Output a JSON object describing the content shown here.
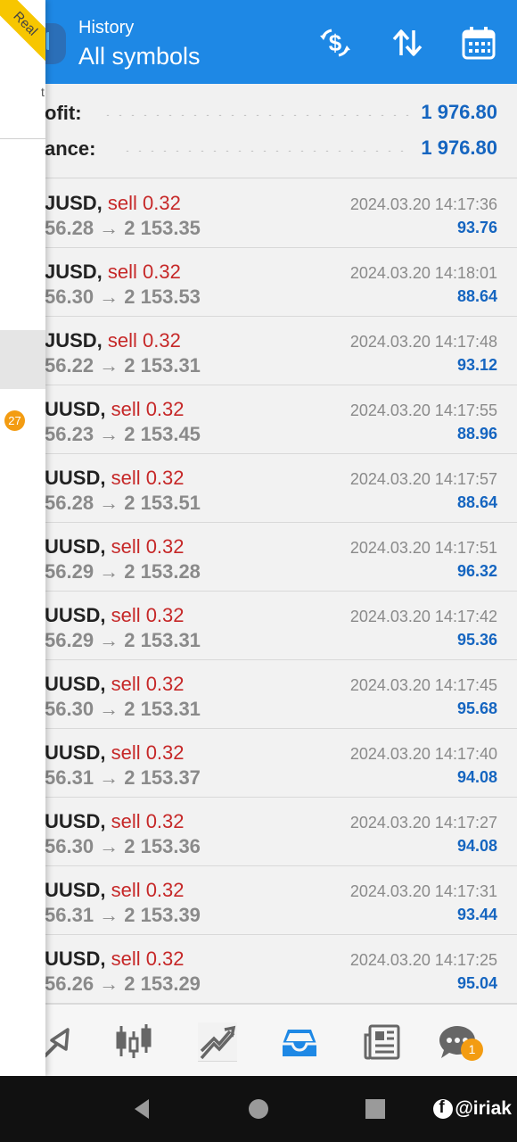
{
  "header": {
    "small_title": "History",
    "big_title": "All symbols",
    "icons": [
      "currency-exchange-icon",
      "sort-icon",
      "calendar-icon"
    ]
  },
  "summary": {
    "profit_label": "ofit:",
    "profit_value": "1 976.80",
    "balance_label": "ance:",
    "balance_value": "1 976.80"
  },
  "drawer": {
    "ribbon_label": "Real",
    "partial_letter": "t",
    "badge": "27"
  },
  "trades": [
    {
      "symbol": "JUSD,",
      "side": "sell 0.32",
      "prices": "56.28 → 2 153.35",
      "time": "2024.03.20 14:17:36",
      "profit": "93.76"
    },
    {
      "symbol": "JUSD,",
      "side": "sell 0.32",
      "prices": "56.30 → 2 153.53",
      "time": "2024.03.20 14:18:01",
      "profit": "88.64"
    },
    {
      "symbol": "JUSD,",
      "side": "sell 0.32",
      "prices": "56.22 → 2 153.31",
      "time": "2024.03.20 14:17:48",
      "profit": "93.12"
    },
    {
      "symbol": "UUSD,",
      "side": "sell 0.32",
      "prices": "56.23 → 2 153.45",
      "time": "2024.03.20 14:17:55",
      "profit": "88.96"
    },
    {
      "symbol": "UUSD,",
      "side": "sell 0.32",
      "prices": "56.28 → 2 153.51",
      "time": "2024.03.20 14:17:57",
      "profit": "88.64"
    },
    {
      "symbol": "UUSD,",
      "side": "sell 0.32",
      "prices": "56.29 → 2 153.28",
      "time": "2024.03.20 14:17:51",
      "profit": "96.32"
    },
    {
      "symbol": "UUSD,",
      "side": "sell 0.32",
      "prices": "56.29 → 2 153.31",
      "time": "2024.03.20 14:17:42",
      "profit": "95.36"
    },
    {
      "symbol": "UUSD,",
      "side": "sell 0.32",
      "prices": "56.30 → 2 153.31",
      "time": "2024.03.20 14:17:45",
      "profit": "95.68"
    },
    {
      "symbol": "UUSD,",
      "side": "sell 0.32",
      "prices": "56.31 → 2 153.37",
      "time": "2024.03.20 14:17:40",
      "profit": "94.08"
    },
    {
      "symbol": "UUSD,",
      "side": "sell 0.32",
      "prices": "56.30 → 2 153.36",
      "time": "2024.03.20 14:17:27",
      "profit": "94.08"
    },
    {
      "symbol": "UUSD,",
      "side": "sell 0.32",
      "prices": "56.31 → 2 153.39",
      "time": "2024.03.20 14:17:31",
      "profit": "93.44"
    },
    {
      "symbol": "UUSD,",
      "side": "sell 0.32",
      "prices": "56.26 → 2 153.29",
      "time": "2024.03.20 14:17:25",
      "profit": "95.04"
    }
  ],
  "bottom_nav": {
    "items": [
      "quotes-icon",
      "chart-icon",
      "trade-icon",
      "history-icon",
      "news-icon",
      "chat-icon"
    ],
    "chat_badge": "1",
    "active_item": "history-icon"
  },
  "system_bar": {
    "watermark": "@iriak"
  },
  "colors": {
    "header_blue": "#1e88e5",
    "sell_red": "#c62828",
    "profit_blue": "#1565c0",
    "badge_orange": "#f39c12"
  }
}
